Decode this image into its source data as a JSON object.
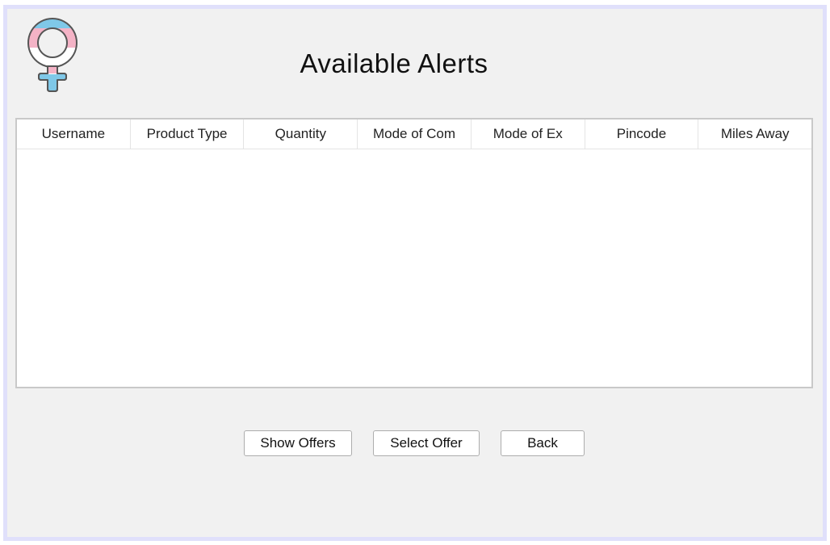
{
  "window": {
    "title": "Available Alerts"
  },
  "logo": {
    "icon": "female-symbol-icon",
    "colors": {
      "blue": "#7fc8e8",
      "pink": "#f4b3c6",
      "white": "#ffffff",
      "outline": "#555555"
    }
  },
  "table": {
    "columns": [
      "Username",
      "Product Type",
      "Quantity",
      "Mode of Com",
      "Mode of Ex",
      "Pincode",
      "Miles Away"
    ],
    "rows": []
  },
  "buttons": {
    "show_offers": "Show Offers",
    "select_offer": "Select Offer",
    "back": "Back"
  },
  "colors": {
    "frame_border": "#e0e0fb",
    "background": "#f1f1f1"
  }
}
